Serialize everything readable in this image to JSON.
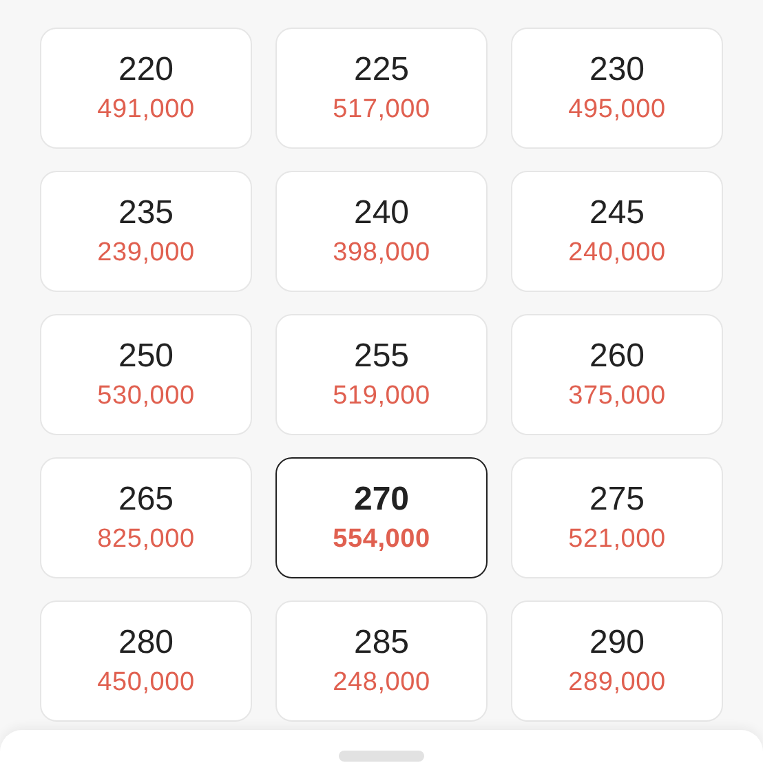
{
  "sizes": [
    {
      "size": "220",
      "price": "491,000",
      "selected": false
    },
    {
      "size": "225",
      "price": "517,000",
      "selected": false
    },
    {
      "size": "230",
      "price": "495,000",
      "selected": false
    },
    {
      "size": "235",
      "price": "239,000",
      "selected": false
    },
    {
      "size": "240",
      "price": "398,000",
      "selected": false
    },
    {
      "size": "245",
      "price": "240,000",
      "selected": false
    },
    {
      "size": "250",
      "price": "530,000",
      "selected": false
    },
    {
      "size": "255",
      "price": "519,000",
      "selected": false
    },
    {
      "size": "260",
      "price": "375,000",
      "selected": false
    },
    {
      "size": "265",
      "price": "825,000",
      "selected": false
    },
    {
      "size": "270",
      "price": "554,000",
      "selected": true
    },
    {
      "size": "275",
      "price": "521,000",
      "selected": false
    },
    {
      "size": "280",
      "price": "450,000",
      "selected": false
    },
    {
      "size": "285",
      "price": "248,000",
      "selected": false
    },
    {
      "size": "290",
      "price": "289,000",
      "selected": false
    }
  ]
}
